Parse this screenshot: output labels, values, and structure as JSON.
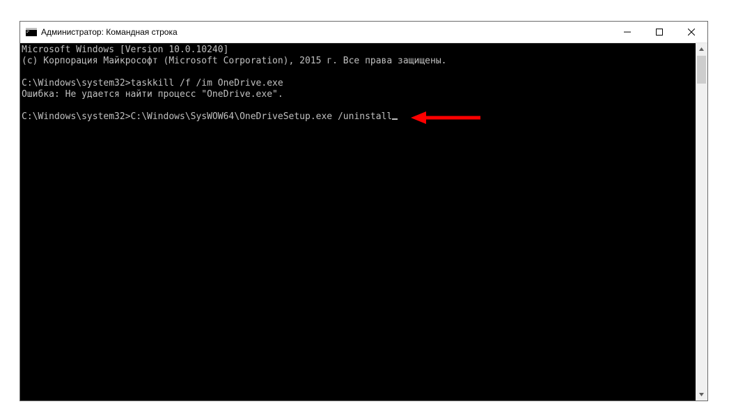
{
  "window": {
    "title": "Администратор: Командная строка"
  },
  "console": {
    "line1": "Microsoft Windows [Version 10.0.10240]",
    "line2": "(c) Корпорация Майкрософт (Microsoft Corporation), 2015 г. Все права защищены.",
    "blank1": "",
    "prompt1": "C:\\Windows\\system32>",
    "cmd1": "taskkill /f /im OneDrive.exe",
    "errline": "Ошибка: Не удается найти процесс \"OneDrive.exe\".",
    "blank2": "",
    "prompt2": "C:\\Windows\\system32>",
    "cmd2": "C:\\Windows\\SysWOW64\\OneDriveSetup.exe /uninstall"
  }
}
